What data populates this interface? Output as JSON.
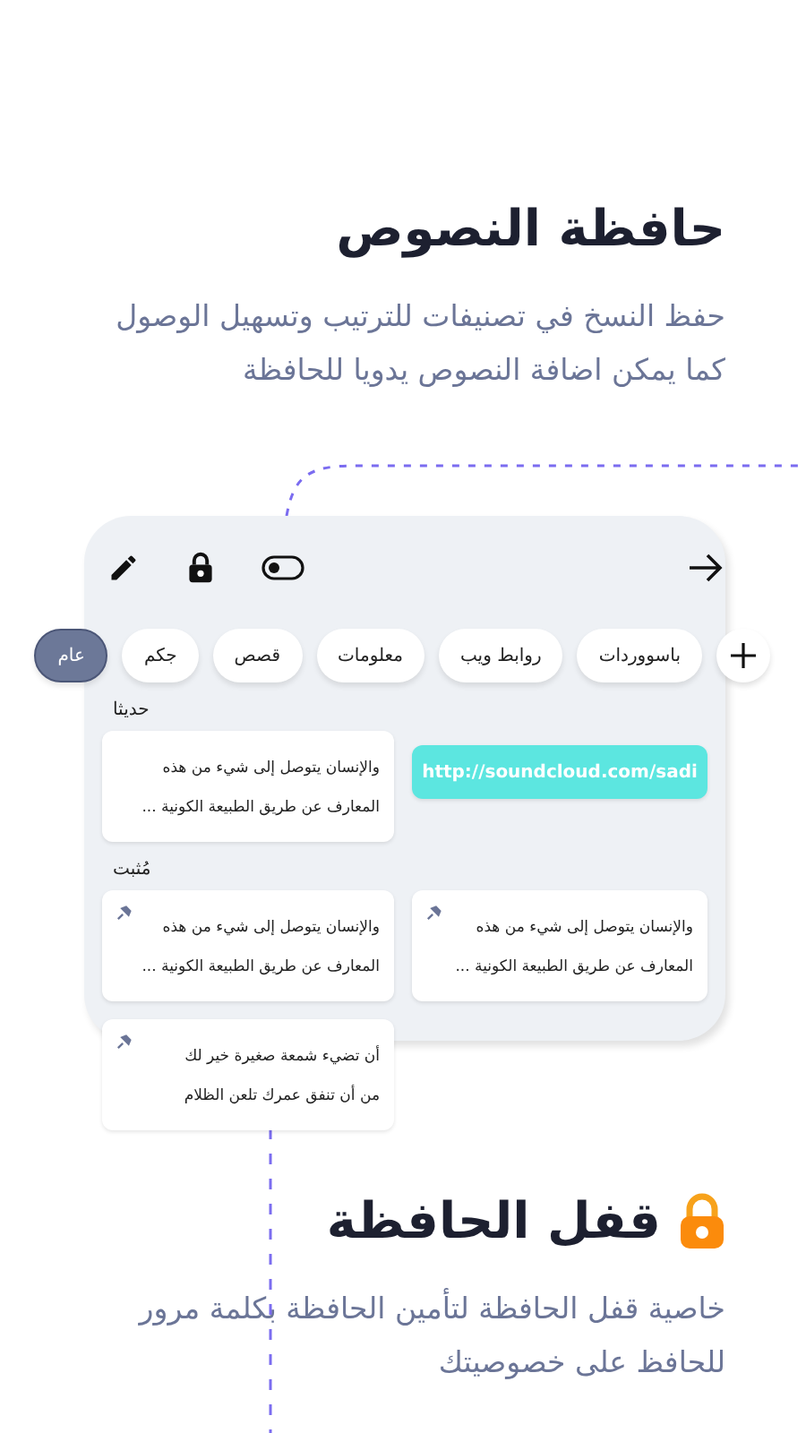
{
  "header": {
    "title": "حافظة النصوص",
    "description": "حفظ النسخ في تصنيفات للترتيب وتسهيل الوصول\nكما يمكن اضافة النصوص يدويا للحافظة"
  },
  "categories": [
    {
      "label": "باسووردات",
      "selected": false
    },
    {
      "label": "روابط ويب",
      "selected": false
    },
    {
      "label": "معلومات",
      "selected": false
    },
    {
      "label": "قصص",
      "selected": false
    },
    {
      "label": "جكم",
      "selected": false
    },
    {
      "label": "عام",
      "selected": true
    }
  ],
  "sections": [
    {
      "title": "حديثا",
      "clips": [
        {
          "kind": "link",
          "text": "http://soundcloud.com/sadi",
          "pinned": false
        },
        {
          "kind": "text",
          "text": "والإنسان يتوصل إلى شيء من هذه\nالمعارف عن طريق الطبيعة الكونية ...",
          "pinned": false
        }
      ]
    },
    {
      "title": "مُثبت",
      "clips": [
        {
          "kind": "text",
          "text": "والإنسان يتوصل إلى شيء من هذه\nالمعارف عن طريق الطبيعة الكونية ...",
          "pinned": true
        },
        {
          "kind": "text",
          "text": "والإنسان يتوصل إلى شيء من هذه\nالمعارف عن طريق الطبيعة الكونية ...",
          "pinned": true
        },
        {
          "kind": "text",
          "text": "أن تضيء شمعة صغيرة خير لك\nمن أن تنفق عمرك تلعن الظلام",
          "pinned": true
        }
      ]
    }
  ],
  "lock_feature": {
    "title": "قفل الحافظة",
    "description": "خاصية قفل الحافظة لتأمين الحافظة بكلمة مرور\nللحافظ على خصوصيتك"
  }
}
